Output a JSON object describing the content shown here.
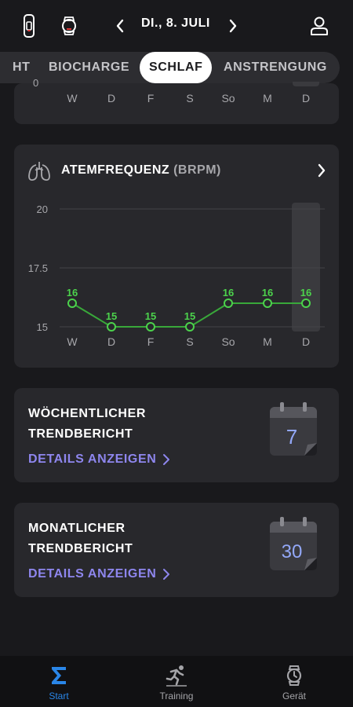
{
  "header": {
    "date": "DI., 8. JULI"
  },
  "tabs": [
    {
      "label": "HT"
    },
    {
      "label": "BIOCHARGE"
    },
    {
      "label": "SCHLAF",
      "active": true
    },
    {
      "label": "ANSTRENGUNG"
    }
  ],
  "top_card": {
    "partial_tick": "0",
    "days": [
      "W",
      "D",
      "F",
      "S",
      "So",
      "M",
      "D"
    ]
  },
  "breathing_card": {
    "title": "ATEMFREQUENZ",
    "unit": "(BRPM)"
  },
  "chart_data": {
    "type": "line",
    "categories": [
      "W",
      "D",
      "F",
      "S",
      "So",
      "M",
      "D"
    ],
    "values": [
      16,
      15,
      15,
      15,
      16,
      16,
      16
    ],
    "y_ticks": [
      "20",
      "17.5",
      "15"
    ],
    "ylim": [
      15,
      20
    ],
    "highlighted_category_index": 6,
    "line_color": "#39a83a",
    "point_label_color": "#4cd24c"
  },
  "weekly_card": {
    "title_line1": "WÖCHENTLICHER",
    "title_line2": "TRENDBERICHT",
    "link": "DETAILS ANZEIGEN",
    "calendar_number": "7"
  },
  "monthly_card": {
    "title_line1": "MONATLICHER",
    "title_line2": "TRENDBERICHT",
    "link": "DETAILS ANZEIGEN",
    "calendar_number": "30"
  },
  "bottom_nav": [
    {
      "label": "Start",
      "icon": "sigma-icon",
      "active": true
    },
    {
      "label": "Training",
      "icon": "runner-icon"
    },
    {
      "label": "Gerät",
      "icon": "watch-icon"
    }
  ],
  "colors": {
    "accent_link": "#8e86ee",
    "nav_active": "#2a86e8",
    "card_bg": "#28282c"
  }
}
